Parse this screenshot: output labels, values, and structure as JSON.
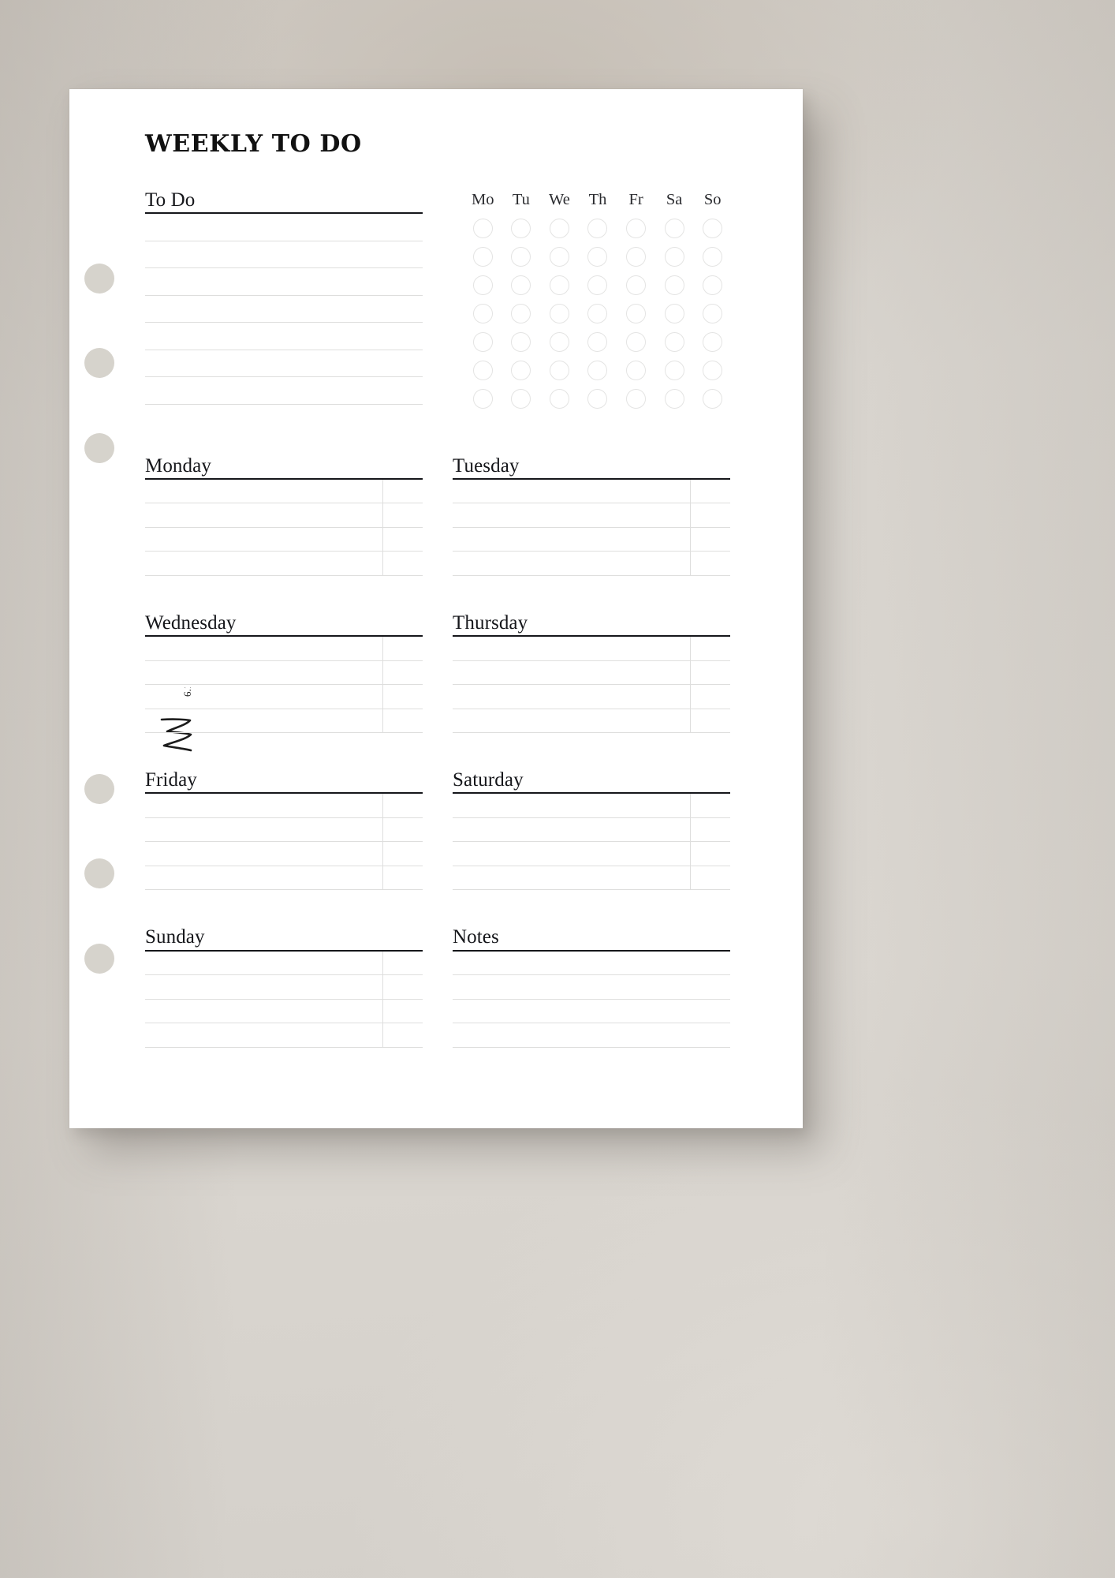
{
  "page": {
    "title": "WEEKLY TO DO"
  },
  "todo": {
    "heading": "To Do",
    "line_count": 7
  },
  "tracker": {
    "weekday_labels": [
      "Mo",
      "Tu",
      "We",
      "Th",
      "Fr",
      "Sa",
      "So"
    ],
    "rows": 7,
    "columns": 7,
    "circle_state": "empty"
  },
  "days": [
    {
      "label": "Monday",
      "line_count": 4,
      "has_divider": true
    },
    {
      "label": "Tuesday",
      "line_count": 4,
      "has_divider": true
    },
    {
      "label": "Wednesday",
      "line_count": 4,
      "has_divider": true
    },
    {
      "label": "Thursday",
      "line_count": 4,
      "has_divider": true
    },
    {
      "label": "Friday",
      "line_count": 4,
      "has_divider": true
    },
    {
      "label": "Saturday",
      "line_count": 4,
      "has_divider": true
    },
    {
      "label": "Sunday",
      "line_count": 4,
      "has_divider": true
    },
    {
      "label": "Notes",
      "line_count": 4,
      "has_divider": false
    }
  ],
  "artist_mark": {
    "text": "6.13",
    "description": "handwritten-signature"
  },
  "punch_holes": {
    "count": 6,
    "color": "#d6d3cc",
    "positions_y": [
      240,
      347,
      455,
      887,
      994,
      1102
    ]
  },
  "colors": {
    "page": "#ffffff",
    "backdrop": "#d9d5cf",
    "ink": "#15161a",
    "rule_light": "#dededd",
    "circle_outline": "#e4e4e3",
    "hole": "#d6d3cc"
  }
}
